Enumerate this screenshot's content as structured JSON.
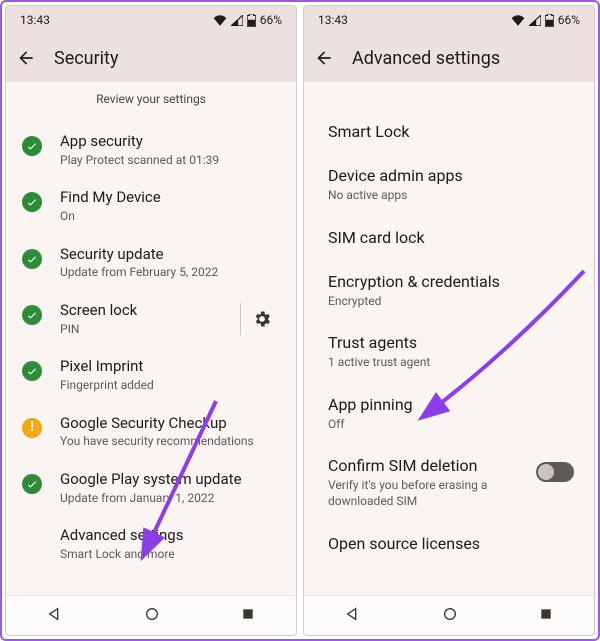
{
  "status": {
    "time": "13:43",
    "battery": "66%"
  },
  "left": {
    "title": "Security",
    "subhead": "Review your settings",
    "items": [
      {
        "icon": "check",
        "title": "App security",
        "sub": "Play Protect scanned at 01:39"
      },
      {
        "icon": "check",
        "title": "Find My Device",
        "sub": "On"
      },
      {
        "icon": "check",
        "title": "Security update",
        "sub": "Update from February 5, 2022"
      },
      {
        "icon": "check",
        "title": "Screen lock",
        "sub": "PIN",
        "gear": true
      },
      {
        "icon": "check",
        "title": "Pixel Imprint",
        "sub": "Fingerprint added"
      },
      {
        "icon": "warn",
        "title": "Google Security Checkup",
        "sub": "You have security recommendations"
      },
      {
        "icon": "check",
        "title": "Google Play system update",
        "sub": "Update from January 1, 2022"
      },
      {
        "icon": "none",
        "title": "Advanced settings",
        "sub": "Smart Lock and more"
      }
    ]
  },
  "right": {
    "title": "Advanced settings",
    "items": [
      {
        "title": "Smart Lock",
        "sub": ""
      },
      {
        "title": "Device admin apps",
        "sub": "No active apps"
      },
      {
        "title": "SIM card lock",
        "sub": ""
      },
      {
        "title": "Encryption & credentials",
        "sub": "Encrypted"
      },
      {
        "title": "Trust agents",
        "sub": "1 active trust agent"
      },
      {
        "title": "App pinning",
        "sub": "Off"
      },
      {
        "title": "Confirm SIM deletion",
        "sub": "Verify it's you before erasing a downloaded SIM",
        "toggle": "off"
      },
      {
        "title": "Open source licenses",
        "sub": ""
      }
    ]
  },
  "annotation_color": "#8e3ee8"
}
